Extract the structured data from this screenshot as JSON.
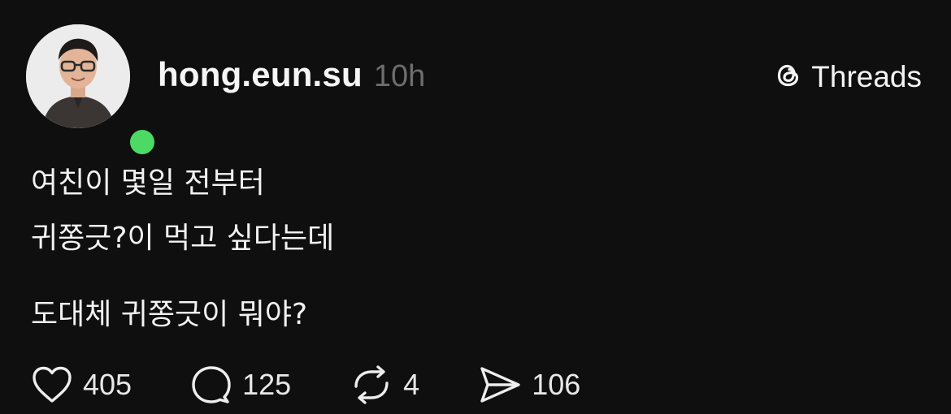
{
  "post": {
    "username": "hong.eun.su",
    "time": "10h",
    "brand": "Threads",
    "online_status_color": "#4cd964",
    "icons": {
      "avatar": "profile-photo",
      "brand": "threads-logo-icon",
      "like": "heart-icon",
      "comment": "comment-bubble-icon",
      "repost": "repost-icon",
      "share": "send-icon"
    },
    "lines": [
      "여친이 몇일 전부터",
      "귀쫑긋?이 먹고 싶다는데",
      "도대체 귀쫑긋이 뭐야?"
    ],
    "stats": {
      "likes": "405",
      "comments": "125",
      "reposts": "4",
      "shares": "106"
    }
  }
}
